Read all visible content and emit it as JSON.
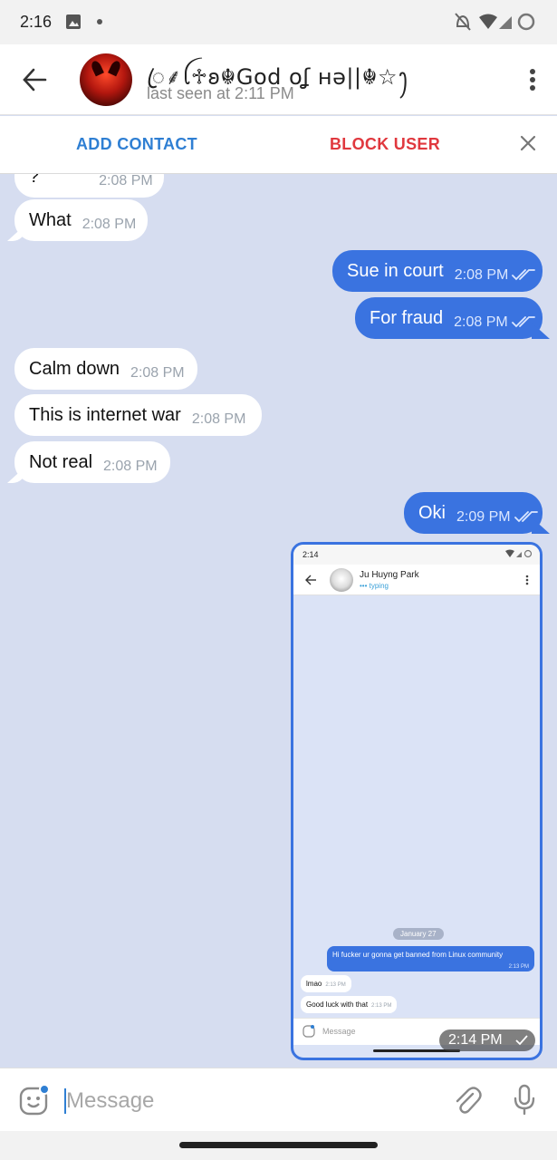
{
  "status_bar": {
    "time": "2:16"
  },
  "header": {
    "contact_name": "ꦿ⸙ꪶ♱𐐪☬God oʆ нǝ||☬☆ꫂ",
    "last_seen": "last seen at 2:11 PM"
  },
  "action_bar": {
    "add_contact": "ADD CONTACT",
    "block_user": "BLOCK USER"
  },
  "messages": [
    {
      "dir": "in",
      "text": "?",
      "time": "2:08 PM"
    },
    {
      "dir": "in",
      "text": "What",
      "time": "2:08 PM"
    },
    {
      "dir": "out",
      "text": "Sue in court",
      "time": "2:08 PM"
    },
    {
      "dir": "out",
      "text": "For fraud",
      "time": "2:08 PM"
    },
    {
      "dir": "in",
      "text": "Calm down",
      "time": "2:08 PM"
    },
    {
      "dir": "in",
      "text": "This is internet war",
      "time": "2:08 PM"
    },
    {
      "dir": "in",
      "text": "Not real",
      "time": "2:08 PM"
    },
    {
      "dir": "out",
      "text": "Oki",
      "time": "2:09 PM"
    }
  ],
  "image_message": {
    "time": "2:14 PM",
    "screenshot": {
      "status_time": "2:14",
      "contact_name": "Ju Huyng Park",
      "typing": "typing",
      "date_chip": "January 27",
      "messages": [
        {
          "dir": "out",
          "text": "Hi fucker ur gonna get banned from Linux community",
          "time": "2:13 PM"
        },
        {
          "dir": "in",
          "text": "lmao",
          "time": "2:13 PM"
        },
        {
          "dir": "in",
          "text": "Good luck with that",
          "time": "2:13 PM"
        }
      ],
      "input_placeholder": "Message"
    }
  },
  "composer": {
    "placeholder": "Message"
  },
  "colors": {
    "accent": "#3a73e0",
    "chat_bg": "#d6ddf0",
    "danger": "#e0383e",
    "link": "#2f7fd3"
  }
}
